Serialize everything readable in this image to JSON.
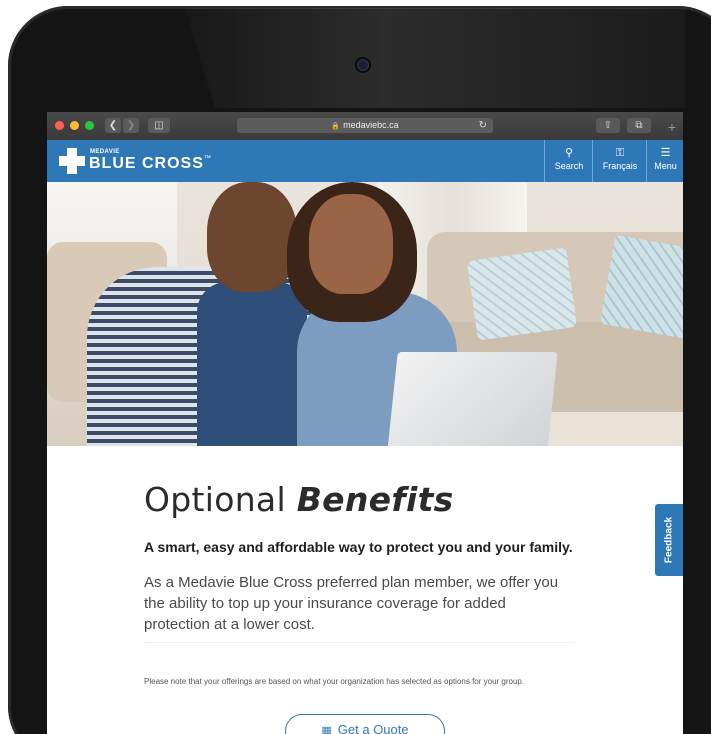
{
  "browser": {
    "url": "medaviebc.ca",
    "back_icon": "chevron-left-icon",
    "forward_icon": "chevron-right-icon",
    "sidebar_icon": "sidebar-icon",
    "share_icon": "share-icon",
    "tabs_icon": "tabs-icon",
    "new_tab_icon": "plus-icon",
    "reload_icon": "reload-icon"
  },
  "header": {
    "logo_small": "MEDAVIE",
    "logo_big": "BLUE CROSS",
    "logo_tm": "™",
    "brand_color": "#2f78b7",
    "nav": {
      "search": "Search",
      "language": "Français",
      "menu": "Menu"
    }
  },
  "content": {
    "title_plain": "Optional",
    "title_emphasis": "Benefits",
    "subtitle": "A smart, easy and affordable way to protect you and your family.",
    "intro": "As a Medavie Blue Cross preferred plan member, we offer you the ability to top up your insurance coverage for added protection at a lower cost.",
    "note": "Please note that your offerings are based on what your organization has selected as options for your group.",
    "quote_button": "Get a Quote"
  },
  "feedback": {
    "label": "Feedback"
  }
}
